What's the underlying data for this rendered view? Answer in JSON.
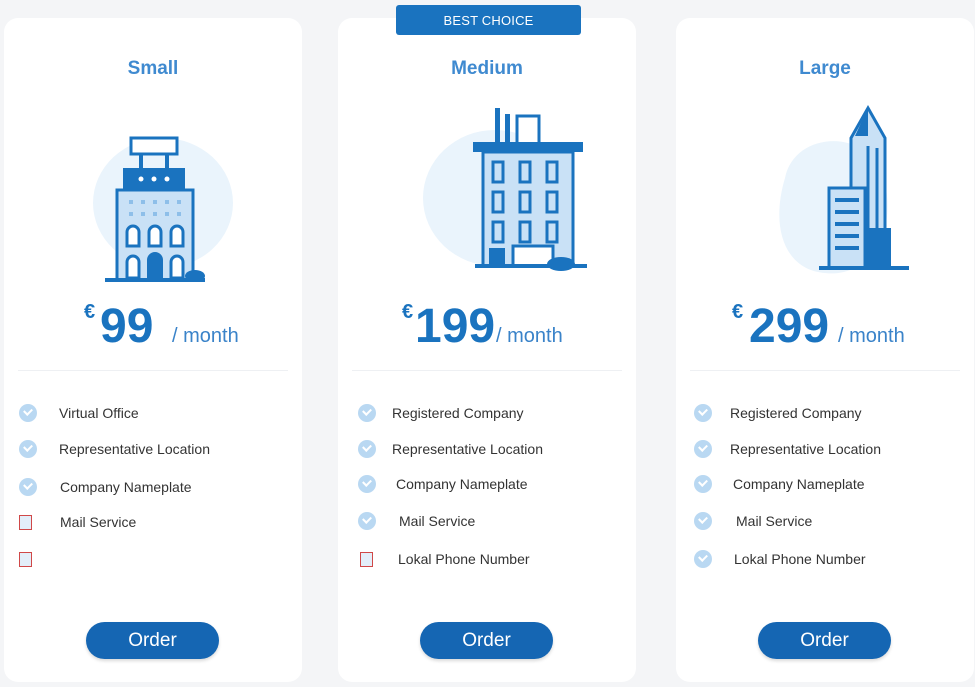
{
  "badge": "BEST CHOICE",
  "plans": [
    {
      "name": "Small",
      "currency": "€",
      "amount": "99",
      "period": "/ month",
      "features": [
        "Virtual Office",
        "Representative Location",
        "Company Nameplate",
        "Mail Service",
        ""
      ],
      "order": "Order"
    },
    {
      "name": "Medium",
      "currency": "€",
      "amount": "199",
      "period": "/ month",
      "features": [
        "Registered Company",
        "Representative Location",
        "Company Nameplate",
        "Mail Service",
        "Lokal Phone Number"
      ],
      "order": "Order"
    },
    {
      "name": "Large",
      "currency": "€",
      "amount": "299",
      "period": "/ month",
      "features": [
        "Registered Company",
        "Representative Location",
        "Company Nameplate",
        "Mail Service",
        "Lokal Phone Number"
      ],
      "order": "Order"
    }
  ],
  "colors": {
    "accent": "#1a73bf",
    "button": "#1566b3",
    "check": "#b9d8f2"
  }
}
